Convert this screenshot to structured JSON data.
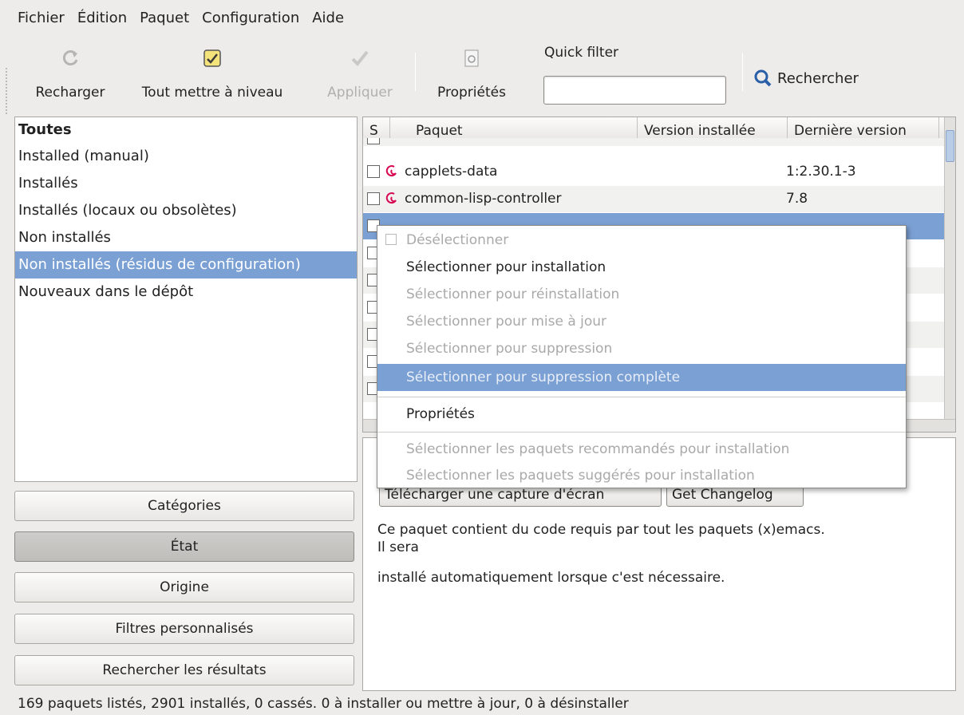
{
  "menubar": {
    "items": [
      "Fichier",
      "Édition",
      "Paquet",
      "Configuration",
      "Aide"
    ]
  },
  "toolbar": {
    "reload_label": "Recharger",
    "upgrade_all_label": "Tout mettre à niveau",
    "apply_label": "Appliquer",
    "properties_label": "Propriétés",
    "quick_filter_label": "Quick filter",
    "quick_filter_value": "",
    "search_label": "Rechercher"
  },
  "filters": {
    "items": [
      "Toutes",
      "Installed (manual)",
      "Installés",
      "Installés (locaux ou obsolètes)",
      "Non installés",
      "Non installés (résidus de configuration)",
      "Nouveaux dans le dépôt"
    ],
    "selected_index": 5
  },
  "side_buttons": {
    "categories": "Catégories",
    "state": "État",
    "origin": "Origine",
    "custom_filters": "Filtres personnalisés",
    "search_results": "Rechercher les résultats"
  },
  "package_table": {
    "columns": [
      "S",
      "Paquet",
      "Version installée",
      "Dernière version"
    ],
    "rows": [
      {
        "name": "capplets-data",
        "latest": "1:2.30.1-3"
      },
      {
        "name": "common-lisp-controller",
        "latest": "7.8"
      }
    ]
  },
  "details": {
    "btn_screenshot": "Télécharger une capture d'écran",
    "btn_changelog": "Get Changelog",
    "desc_line1": "Ce paquet contient du code requis par tout les paquets (x)emacs.",
    "desc_line2": "Il sera",
    "desc_line3": "installé automatiquement lorsque c'est nécessaire."
  },
  "context_menu": {
    "unselect": "Désélectionner",
    "mark_install": "Sélectionner pour installation",
    "mark_reinstall": "Sélectionner pour réinstallation",
    "mark_upgrade": "Sélectionner pour mise à jour",
    "mark_remove": "Sélectionner pour suppression",
    "mark_purge": "Sélectionner pour suppression complète",
    "properties": "Propriétés",
    "mark_recommended": "Sélectionner les paquets recommandés pour installation",
    "mark_suggested": "Sélectionner les paquets suggérés pour installation"
  },
  "statusbar": {
    "text": "169 paquets listés, 2901 installés, 0 cassés. 0 à installer ou mettre à jour, 0 à désinstaller"
  },
  "colors": {
    "selection": "#7ba0d4",
    "debian_swirl": "#d70751",
    "search_icon": "#2a5fa8"
  }
}
